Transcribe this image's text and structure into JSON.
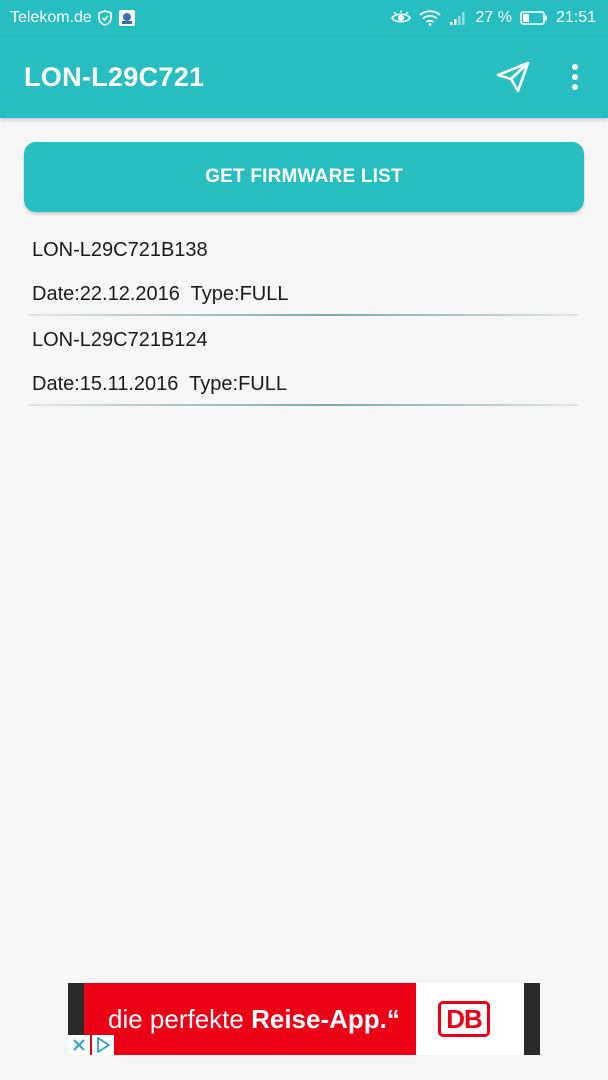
{
  "status_bar": {
    "carrier": "Telekom.de",
    "battery": "27 %",
    "time": "21:51",
    "icons": [
      "shield-icon",
      "app-notification-icon",
      "eye-icon",
      "wifi-icon",
      "signal-icon",
      "battery-icon"
    ]
  },
  "app_bar": {
    "title": "LON-L29C721",
    "actions": [
      "send-icon",
      "more-vert-icon"
    ]
  },
  "main": {
    "get_firmware_label": "GET FIRMWARE LIST",
    "firmware_items": [
      {
        "name": "LON-L29C721B138",
        "meta": "Date:22.12.2016  Type:FULL"
      },
      {
        "name": "LON-L29C721B124",
        "meta": "Date:15.11.2016  Type:FULL"
      }
    ]
  },
  "ad": {
    "text_prefix": "die perfekte ",
    "text_bold": "Reise-App.“",
    "logo": "DB",
    "controls": [
      "close-icon",
      "adchoices-icon"
    ]
  },
  "colors": {
    "accent": "#26bec0",
    "background": "#f6f6f6",
    "ad_red": "#ec0016"
  }
}
